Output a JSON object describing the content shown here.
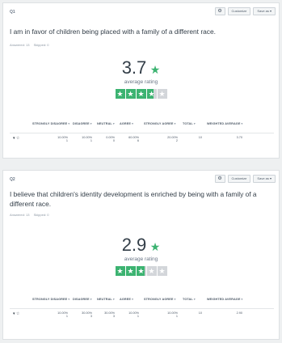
{
  "cards": [
    {
      "q_label": "Q1",
      "toolbar": {
        "icon": "settings-icon",
        "customize": "Customize",
        "save_as": "Save as ▾"
      },
      "question": "I am in favor of children being placed with a family of a different race.",
      "answered": "Answered: 13",
      "skipped": "Skipped: 0",
      "rating": {
        "value": "3.7",
        "fraction": 0.74,
        "label": "average rating"
      },
      "stars": [
        1,
        1,
        1,
        0.7,
        0
      ],
      "columns": [
        "STRONGLY DISAGREE",
        "DISAGREE",
        "NEUTRAL",
        "AGREE",
        "STRONGLY AGREE",
        "TOTAL",
        "WEIGHTED AVERAGE"
      ],
      "row": {
        "icons": "▾ ☆",
        "cells": [
          {
            "pct": "10.00%",
            "count": "1"
          },
          {
            "pct": "10.00%",
            "count": "1"
          },
          {
            "pct": "0.00%",
            "count": "0"
          },
          {
            "pct": "60.00%",
            "count": "6"
          },
          {
            "pct": "20.00%",
            "count": "2"
          },
          {
            "pct": "",
            "count": "10"
          },
          {
            "pct": "",
            "count": "3.70"
          }
        ]
      }
    },
    {
      "q_label": "Q2",
      "toolbar": {
        "icon": "settings-icon",
        "customize": "Customize",
        "save_as": "Save as ▾"
      },
      "question": "I believe that children's identity development is enriched by being with a family of a different race.",
      "answered": "Answered: 13",
      "skipped": "Skipped: 0",
      "rating": {
        "value": "2.9",
        "fraction": 0.58,
        "label": "average rating"
      },
      "stars": [
        1,
        1,
        0.9,
        0,
        0
      ],
      "columns": [
        "STRONGLY DISAGREE",
        "DISAGREE",
        "NEUTRAL",
        "AGREE",
        "STRONGLY AGREE",
        "TOTAL",
        "WEIGHTED AVERAGE"
      ],
      "row": {
        "icons": "▾ ☆",
        "cells": [
          {
            "pct": "10.00%",
            "count": "1"
          },
          {
            "pct": "30.00%",
            "count": "3"
          },
          {
            "pct": "30.00%",
            "count": "3"
          },
          {
            "pct": "10.00%",
            "count": "1"
          },
          {
            "pct": "10.00%",
            "count": "1"
          },
          {
            "pct": "",
            "count": "10"
          },
          {
            "pct": "",
            "count": "2.90"
          }
        ]
      }
    }
  ],
  "colors": {
    "accent": "#3cb371",
    "star_empty": "#d3d6da",
    "text": "#333e48"
  }
}
